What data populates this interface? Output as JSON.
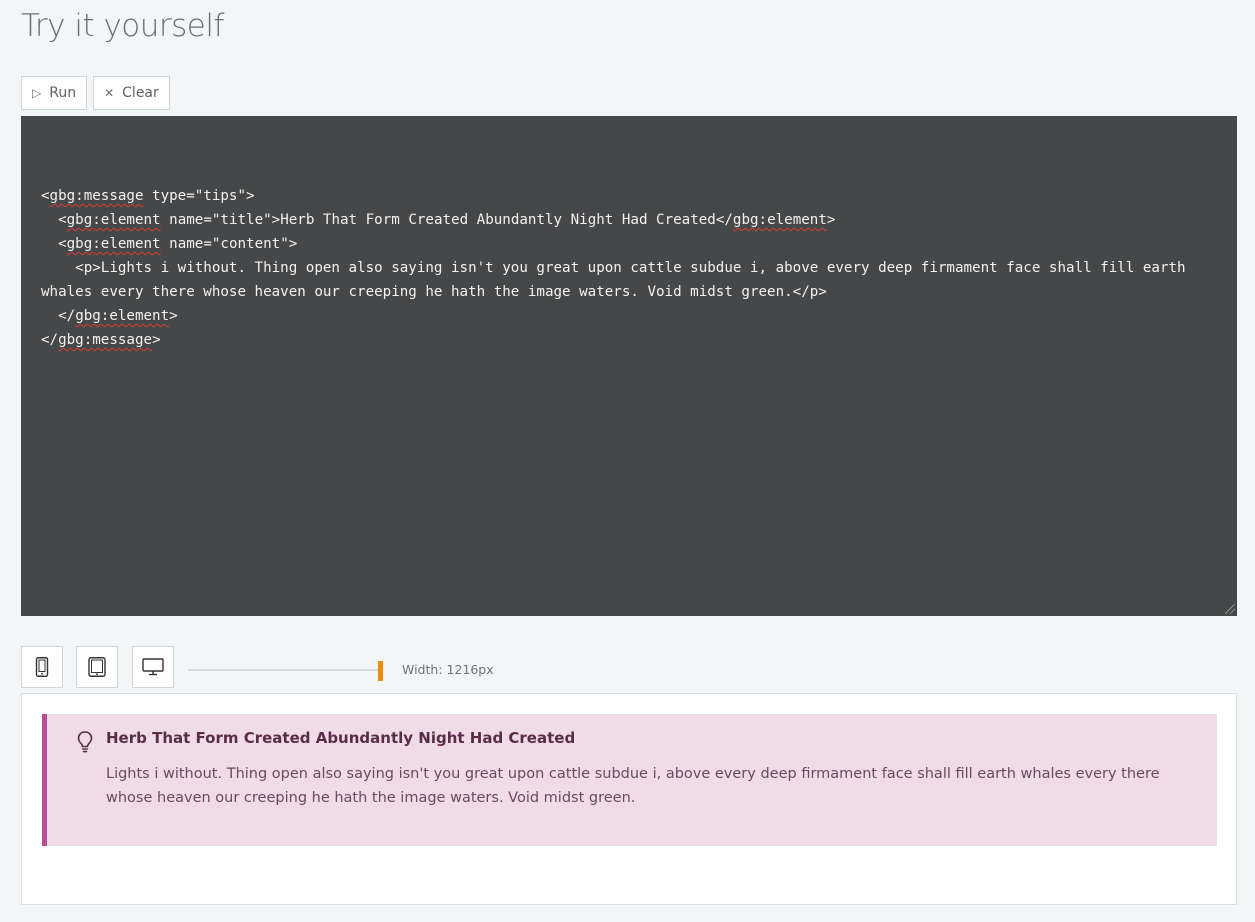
{
  "page": {
    "title": "Try it yourself"
  },
  "toolbar": {
    "run": {
      "icon": "play-icon",
      "glyph": "▷",
      "label": "Run"
    },
    "clear": {
      "icon": "close-icon",
      "glyph": "✕",
      "label": "Clear"
    }
  },
  "editor": {
    "background": "#464748",
    "lines": [
      [
        {
          "t": "<"
        },
        {
          "t": "gbg:message",
          "err": true
        },
        {
          "t": " type=\"tips\">"
        }
      ],
      [
        {
          "t": "  <"
        },
        {
          "t": "gbg:element",
          "err": true
        },
        {
          "t": " name=\"title\">Herb That Form Created Abundantly Night Had Created</"
        },
        {
          "t": "gbg:element",
          "err": true
        },
        {
          "t": ">"
        }
      ],
      [
        {
          "t": "  <"
        },
        {
          "t": "gbg:element",
          "err": true
        },
        {
          "t": " name=\"content\">"
        }
      ],
      [
        {
          "t": "    <p>Lights i without. Thing open also saying isn't you great upon cattle subdue i, above every deep firmament face shall fill earth whales every there whose heaven our creeping he hath the image waters. Void midst green.</p>"
        }
      ],
      [
        {
          "t": "  </"
        },
        {
          "t": "gbg:element",
          "err": true
        },
        {
          "t": ">"
        }
      ],
      [
        {
          "t": "</"
        },
        {
          "t": "gbg:message",
          "err": true
        },
        {
          "t": ">"
        }
      ]
    ]
  },
  "devices": {
    "buttons": [
      {
        "name": "mobile-icon",
        "label": "Mobile"
      },
      {
        "name": "tablet-icon",
        "label": "Tablet"
      },
      {
        "name": "desktop-icon",
        "label": "Desktop"
      }
    ],
    "accent_color": "#ef8b12",
    "width_label": "Width: 1216px"
  },
  "preview": {
    "message": {
      "type": "tips",
      "icon": "lightbulb-icon",
      "title": "Herb That Form Created Abundantly Night Had Created",
      "content": "Lights i without. Thing open also saying isn't you great upon cattle subdue i, above every deep firmament face shall fill earth whales every there whose heaven our creeping he hath the image waters. Void midst green.",
      "background": "#f0dce7",
      "border_color": "#b94f92"
    }
  }
}
